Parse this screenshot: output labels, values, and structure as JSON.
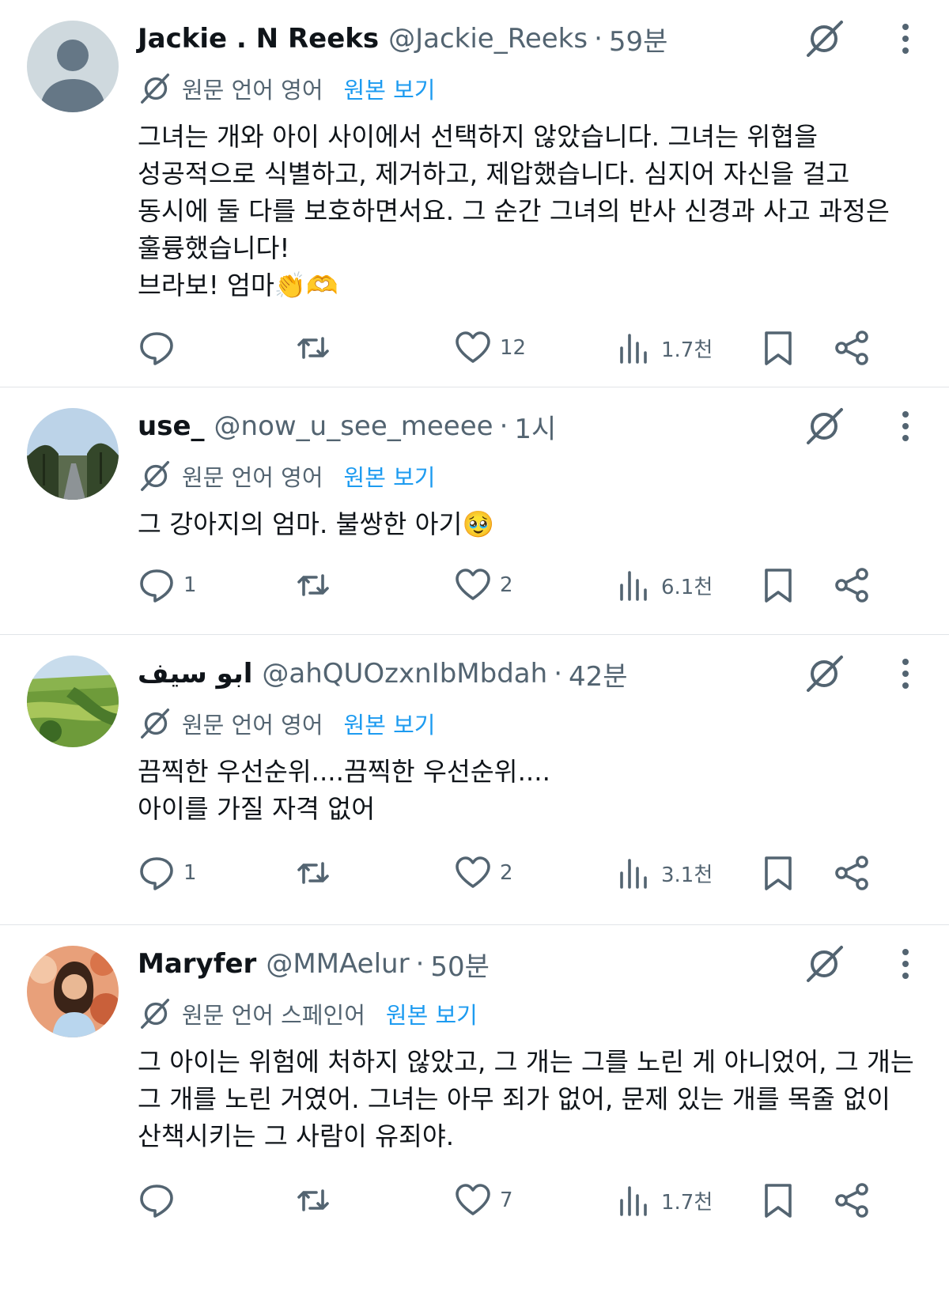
{
  "icons": {
    "reply": "reply-icon",
    "retweet": "retweet-icon",
    "like": "heart-icon",
    "views": "views-icon",
    "bookmark": "bookmark-icon",
    "share": "share-icon",
    "grok": "grok-icon",
    "more": "more-icon",
    "translate": "translate-icon"
  },
  "colors": {
    "link": "#1d9bf0",
    "secondary": "#536471",
    "text": "#0f1419",
    "divider": "#e1e4e8"
  },
  "posts": [
    {
      "display_name": "Jackie . N Reeks",
      "handle": "@Jackie_Reeks",
      "separator": "·",
      "time": "59분",
      "translation_label": "원문 언어 영어",
      "view_original": "원본 보기",
      "text": "그녀는 개와 아이 사이에서 선택하지 않았습니다. 그녀는 위협을\n성공적으로 식별하고, 제거하고, 제압했습니다. 심지어 자신을 걸고\n동시에 둘 다를 보호하면서요. 그 순간 그녀의 반사 신경과 사고 과정은\n훌륭했습니다!\n브라보! 엄마👏🫶",
      "replies": "",
      "likes": "12",
      "views": "1.7천",
      "avatar": "default-avatar"
    },
    {
      "display_name": "use_",
      "handle": "@now_u_see_meeee",
      "separator": "·",
      "time": "1시",
      "translation_label": "원문 언어 영어",
      "view_original": "원본 보기",
      "text": "그 강아지의 엄마. 불쌍한 아기🥹",
      "replies": "1",
      "likes": "2",
      "views": "6.1천",
      "avatar": "road-photo-avatar"
    },
    {
      "display_name": "ابو سيف",
      "handle": "@ahQUOzxnIbMbdah",
      "separator": "·",
      "time": "42분",
      "translation_label": "원문 언어 영어",
      "view_original": "원본 보기",
      "text": "끔찍한 우선순위....끔찍한 우선순위....\n아이를 가질 자격 없어",
      "replies": "1",
      "likes": "2",
      "views": "3.1천",
      "avatar": "landscape-avatar"
    },
    {
      "display_name": "Maryfer",
      "handle": "@MMAelur",
      "separator": "·",
      "time": "50분",
      "translation_label": "원문 언어 스페인어",
      "view_original": "원본 보기",
      "text": "그 아이는 위험에 처하지 않았고, 그 개는 그를 노린 게 아니었어, 그 개는\n그 개를 노린 거였어. 그녀는 아무 죄가 없어, 문제 있는 개를 목줄 없이\n산책시키는 그 사람이 유죄야.",
      "replies": "",
      "likes": "7",
      "views": "1.7천",
      "avatar": "illustrated-woman-avatar"
    }
  ]
}
